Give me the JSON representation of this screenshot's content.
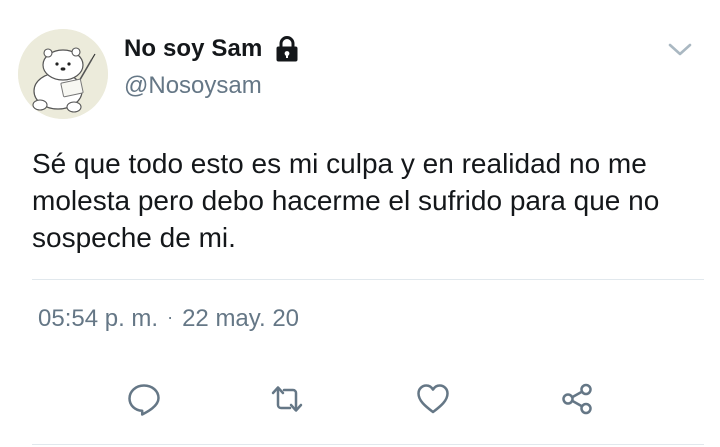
{
  "tweet": {
    "display_name": "No soy Sam",
    "handle": "@Nosoysam",
    "text": "Sé que todo esto es mi culpa y en realidad no me molesta pero debo hacerme el sufrido para que no sospeche de mi.",
    "time": "05:54 p. m.",
    "separator": "·",
    "date": "22 may. 20"
  },
  "icons": {
    "avatar": "polar-bear-drawing-avatar",
    "protected": "lock-icon",
    "menu": "chevron-down-icon",
    "reply": "reply-icon",
    "retweet": "retweet-icon",
    "like": "heart-icon",
    "share": "share-icon"
  },
  "colors": {
    "text": "#14171a",
    "secondary": "#657786",
    "divider": "#e1e8ed",
    "avatar_bg": "#ecebdb"
  }
}
